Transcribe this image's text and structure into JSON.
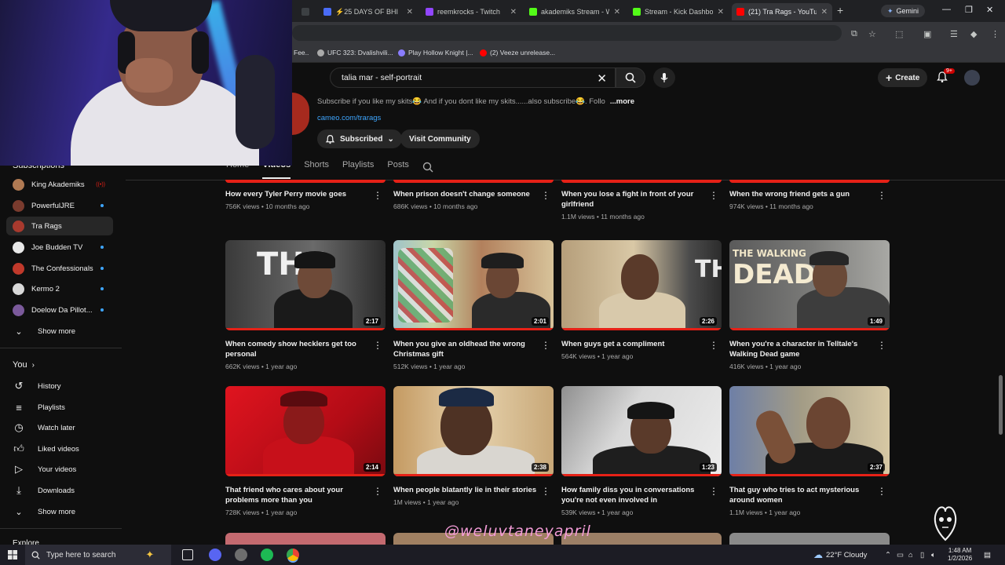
{
  "browser": {
    "tabs": [
      {
        "label": "⚡25 DAYS OF BHI",
        "color": "#4a6cf7"
      },
      {
        "label": "reemkrocks - Twitch",
        "color": "#9146ff"
      },
      {
        "label": "akademiks Stream - W",
        "color": "#53fc18"
      },
      {
        "label": "Stream - Kick Dashboa",
        "color": "#53fc18"
      },
      {
        "label": "(21) Tra Rags - YouTube",
        "color": "#ff0000"
      }
    ],
    "gemini_label": "Gemini",
    "bookmarks": [
      {
        "label": "Fee..",
        "color": "#888888"
      },
      {
        "label": "UFC 323: Dvalishvili...",
        "color": "#aaaaaa"
      },
      {
        "label": "Play Hollow Knight |...",
        "color": "#8a7dff"
      },
      {
        "label": "(2) Veeze unrelease...",
        "color": "#ff0000"
      }
    ]
  },
  "youtube": {
    "search_value": "talia mar - self-portrait",
    "create_label": "Create",
    "notification_count": "9+",
    "channel": {
      "description": "Subscribe if you like my skits😂 And if you dont like my skits......also subscribe😂. Follo",
      "more_label": "...more",
      "link": "cameo.com/trarags",
      "subscribed_label": "Subscribed",
      "community_label": "Visit Community",
      "tabs": [
        "Home",
        "Videos",
        "Shorts",
        "Playlists",
        "Posts"
      ]
    },
    "sidebar": {
      "subscriptions_label": "Subscriptions",
      "subscriptions": [
        {
          "label": "King Akademiks",
          "status": "live",
          "color": "#b07a53"
        },
        {
          "label": "PowerfulJRE",
          "status": "new",
          "color": "#7a3b2e"
        },
        {
          "label": "Tra Rags",
          "status": "",
          "color": "#a83a2e"
        },
        {
          "label": "Joe Budden TV",
          "status": "new",
          "color": "#e8e8e8"
        },
        {
          "label": "The Confessionals",
          "status": "new",
          "color": "#c0392b"
        },
        {
          "label": "Kermo 2",
          "status": "new",
          "color": "#d8d8d8"
        },
        {
          "label": "Doelow Da Pillot...",
          "status": "new",
          "color": "#7b5a9b"
        }
      ],
      "show_more_label": "Show more",
      "you_label": "You",
      "you_items": [
        {
          "label": "History",
          "icon": "history-icon"
        },
        {
          "label": "Playlists",
          "icon": "playlists-icon"
        },
        {
          "label": "Watch later",
          "icon": "watch-later-icon"
        },
        {
          "label": "Liked videos",
          "icon": "liked-videos-icon"
        },
        {
          "label": "Your videos",
          "icon": "your-videos-icon"
        },
        {
          "label": "Downloads",
          "icon": "downloads-icon"
        }
      ],
      "show_more_label_2": "Show more",
      "explore_label": "Explore"
    },
    "videos": [
      {
        "title": "How every Tyler Perry movie goes",
        "meta": "756K views • 10 months ago",
        "duration": ""
      },
      {
        "title": "When prison doesn't change someone",
        "meta": "686K views • 10 months ago",
        "duration": ""
      },
      {
        "title": "When you lose a fight in front of your girlfriend",
        "meta": "1.1M views • 11 months ago",
        "duration": ""
      },
      {
        "title": "When the wrong friend gets a gun",
        "meta": "974K views • 11 months ago",
        "duration": ""
      },
      {
        "title": "When comedy show hecklers get too personal",
        "meta": "662K views • 1 year ago",
        "duration": "2:17",
        "thumb_text": "THE"
      },
      {
        "title": "When you give an oldhead the wrong Christmas gift",
        "meta": "512K views • 1 year ago",
        "duration": "2:01"
      },
      {
        "title": "When guys get a compliment",
        "meta": "564K views • 1 year ago",
        "duration": "2:26",
        "thumb_text": "TH"
      },
      {
        "title": "When you're a character in Telltale's Walking Dead game",
        "meta": "416K views • 1 year ago",
        "duration": "1:49",
        "thumb_text_small": "THE WALKING",
        "thumb_text_big": "DEAD"
      },
      {
        "title": "That friend who cares about your problems more than you",
        "meta": "728K views • 1 year ago",
        "duration": "2:14"
      },
      {
        "title": "When people blatantly lie in their stories",
        "meta": "1M views • 1 year ago",
        "duration": "2:38"
      },
      {
        "title": "How family diss you in conversations you're not even involved in",
        "meta": "539K views • 1 year ago",
        "duration": "1:23"
      },
      {
        "title": "That guy who tries to act mysterious around women",
        "meta": "1.1M views • 1 year ago",
        "duration": "2:37"
      }
    ]
  },
  "overlay": {
    "watermark": "@weluvtaneyapril"
  },
  "taskbar": {
    "search_placeholder": "Type here to search",
    "weather": "22°F  Cloudy",
    "time": "1:48 AM",
    "date": "1/2/2026"
  }
}
